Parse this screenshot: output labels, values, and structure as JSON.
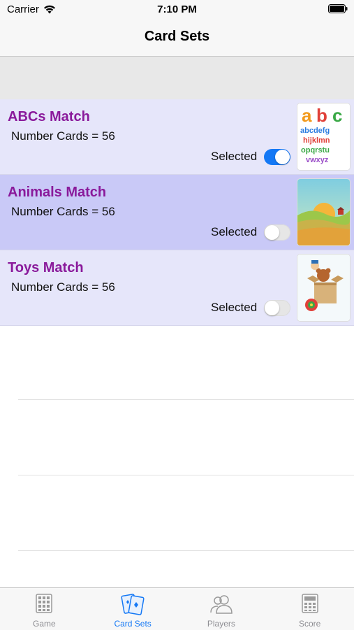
{
  "status_bar": {
    "carrier": "Carrier",
    "time": "7:10 PM"
  },
  "nav": {
    "title": "Card Sets"
  },
  "card_sets": [
    {
      "title": "ABCs Match",
      "count_text": "Number Cards = 56",
      "selected_label": "Selected",
      "selected": true,
      "highlighted": false
    },
    {
      "title": "Animals Match",
      "count_text": "Number Cards = 56",
      "selected_label": "Selected",
      "selected": false,
      "highlighted": true
    },
    {
      "title": "Toys Match",
      "count_text": "Number Cards = 56",
      "selected_label": "Selected",
      "selected": false,
      "highlighted": false
    }
  ],
  "tabs": [
    {
      "label": "Game",
      "icon": "calculator-grid-icon",
      "active": false
    },
    {
      "label": "Card Sets",
      "icon": "cards-icon",
      "active": true
    },
    {
      "label": "Players",
      "icon": "people-icon",
      "active": false
    },
    {
      "label": "Score",
      "icon": "calculator-icon",
      "active": false
    }
  ],
  "colors": {
    "accent": "#1478f5",
    "title": "#8a1a9b",
    "cell_bg": "#e6e6fa",
    "cell_highlight": "#c9c9f7"
  }
}
